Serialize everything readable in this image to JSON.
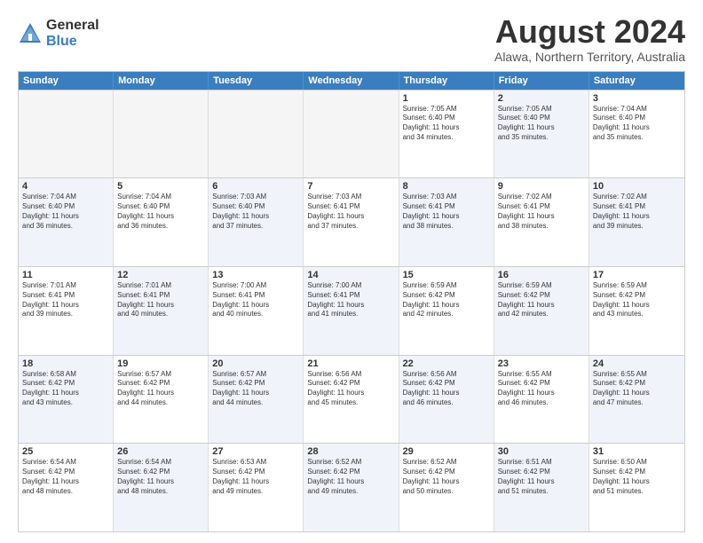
{
  "logo": {
    "general": "General",
    "blue": "Blue"
  },
  "title": "August 2024",
  "subtitle": "Alawa, Northern Territory, Australia",
  "days": [
    "Sunday",
    "Monday",
    "Tuesday",
    "Wednesday",
    "Thursday",
    "Friday",
    "Saturday"
  ],
  "weeks": [
    [
      {
        "num": "",
        "text": "",
        "empty": true
      },
      {
        "num": "",
        "text": "",
        "empty": true
      },
      {
        "num": "",
        "text": "",
        "empty": true
      },
      {
        "num": "",
        "text": "",
        "empty": true
      },
      {
        "num": "1",
        "text": "Sunrise: 7:05 AM\nSunset: 6:40 PM\nDaylight: 11 hours\nand 34 minutes.",
        "alt": false
      },
      {
        "num": "2",
        "text": "Sunrise: 7:05 AM\nSunset: 6:40 PM\nDaylight: 11 hours\nand 35 minutes.",
        "alt": true
      },
      {
        "num": "3",
        "text": "Sunrise: 7:04 AM\nSunset: 6:40 PM\nDaylight: 11 hours\nand 35 minutes.",
        "alt": false
      }
    ],
    [
      {
        "num": "4",
        "text": "Sunrise: 7:04 AM\nSunset: 6:40 PM\nDaylight: 11 hours\nand 36 minutes.",
        "alt": true
      },
      {
        "num": "5",
        "text": "Sunrise: 7:04 AM\nSunset: 6:40 PM\nDaylight: 11 hours\nand 36 minutes.",
        "alt": false
      },
      {
        "num": "6",
        "text": "Sunrise: 7:03 AM\nSunset: 6:40 PM\nDaylight: 11 hours\nand 37 minutes.",
        "alt": true
      },
      {
        "num": "7",
        "text": "Sunrise: 7:03 AM\nSunset: 6:41 PM\nDaylight: 11 hours\nand 37 minutes.",
        "alt": false
      },
      {
        "num": "8",
        "text": "Sunrise: 7:03 AM\nSunset: 6:41 PM\nDaylight: 11 hours\nand 38 minutes.",
        "alt": true
      },
      {
        "num": "9",
        "text": "Sunrise: 7:02 AM\nSunset: 6:41 PM\nDaylight: 11 hours\nand 38 minutes.",
        "alt": false
      },
      {
        "num": "10",
        "text": "Sunrise: 7:02 AM\nSunset: 6:41 PM\nDaylight: 11 hours\nand 39 minutes.",
        "alt": true
      }
    ],
    [
      {
        "num": "11",
        "text": "Sunrise: 7:01 AM\nSunset: 6:41 PM\nDaylight: 11 hours\nand 39 minutes.",
        "alt": false
      },
      {
        "num": "12",
        "text": "Sunrise: 7:01 AM\nSunset: 6:41 PM\nDaylight: 11 hours\nand 40 minutes.",
        "alt": true
      },
      {
        "num": "13",
        "text": "Sunrise: 7:00 AM\nSunset: 6:41 PM\nDaylight: 11 hours\nand 40 minutes.",
        "alt": false
      },
      {
        "num": "14",
        "text": "Sunrise: 7:00 AM\nSunset: 6:41 PM\nDaylight: 11 hours\nand 41 minutes.",
        "alt": true
      },
      {
        "num": "15",
        "text": "Sunrise: 6:59 AM\nSunset: 6:42 PM\nDaylight: 11 hours\nand 42 minutes.",
        "alt": false
      },
      {
        "num": "16",
        "text": "Sunrise: 6:59 AM\nSunset: 6:42 PM\nDaylight: 11 hours\nand 42 minutes.",
        "alt": true
      },
      {
        "num": "17",
        "text": "Sunrise: 6:59 AM\nSunset: 6:42 PM\nDaylight: 11 hours\nand 43 minutes.",
        "alt": false
      }
    ],
    [
      {
        "num": "18",
        "text": "Sunrise: 6:58 AM\nSunset: 6:42 PM\nDaylight: 11 hours\nand 43 minutes.",
        "alt": true
      },
      {
        "num": "19",
        "text": "Sunrise: 6:57 AM\nSunset: 6:42 PM\nDaylight: 11 hours\nand 44 minutes.",
        "alt": false
      },
      {
        "num": "20",
        "text": "Sunrise: 6:57 AM\nSunset: 6:42 PM\nDaylight: 11 hours\nand 44 minutes.",
        "alt": true
      },
      {
        "num": "21",
        "text": "Sunrise: 6:56 AM\nSunset: 6:42 PM\nDaylight: 11 hours\nand 45 minutes.",
        "alt": false
      },
      {
        "num": "22",
        "text": "Sunrise: 6:56 AM\nSunset: 6:42 PM\nDaylight: 11 hours\nand 46 minutes.",
        "alt": true
      },
      {
        "num": "23",
        "text": "Sunrise: 6:55 AM\nSunset: 6:42 PM\nDaylight: 11 hours\nand 46 minutes.",
        "alt": false
      },
      {
        "num": "24",
        "text": "Sunrise: 6:55 AM\nSunset: 6:42 PM\nDaylight: 11 hours\nand 47 minutes.",
        "alt": true
      }
    ],
    [
      {
        "num": "25",
        "text": "Sunrise: 6:54 AM\nSunset: 6:42 PM\nDaylight: 11 hours\nand 48 minutes.",
        "alt": false
      },
      {
        "num": "26",
        "text": "Sunrise: 6:54 AM\nSunset: 6:42 PM\nDaylight: 11 hours\nand 48 minutes.",
        "alt": true
      },
      {
        "num": "27",
        "text": "Sunrise: 6:53 AM\nSunset: 6:42 PM\nDaylight: 11 hours\nand 49 minutes.",
        "alt": false
      },
      {
        "num": "28",
        "text": "Sunrise: 6:52 AM\nSunset: 6:42 PM\nDaylight: 11 hours\nand 49 minutes.",
        "alt": true
      },
      {
        "num": "29",
        "text": "Sunrise: 6:52 AM\nSunset: 6:42 PM\nDaylight: 11 hours\nand 50 minutes.",
        "alt": false
      },
      {
        "num": "30",
        "text": "Sunrise: 6:51 AM\nSunset: 6:42 PM\nDaylight: 11 hours\nand 51 minutes.",
        "alt": true
      },
      {
        "num": "31",
        "text": "Sunrise: 6:50 AM\nSunset: 6:42 PM\nDaylight: 11 hours\nand 51 minutes.",
        "alt": false
      }
    ]
  ]
}
